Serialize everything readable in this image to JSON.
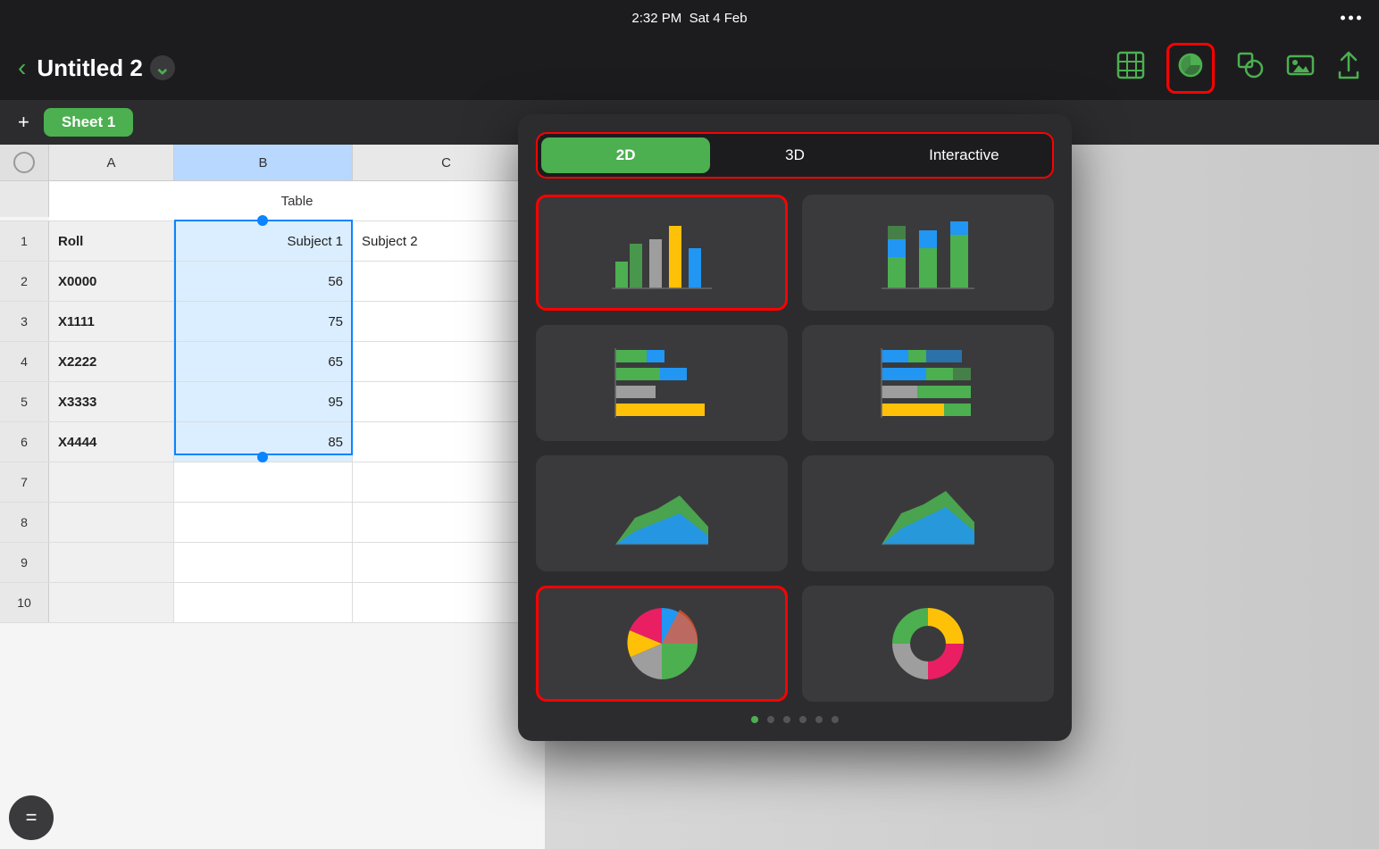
{
  "statusBar": {
    "time": "2:32 PM",
    "date": "Sat 4 Feb"
  },
  "toolbar": {
    "backLabel": "‹",
    "title": "Untitled 2",
    "chevron": "⌄",
    "icons": {
      "table": "table-icon",
      "chart": "chart-icon",
      "shape": "shape-icon",
      "media": "media-icon",
      "share": "share-icon"
    }
  },
  "sheetBar": {
    "addLabel": "+",
    "sheets": [
      "Sheet 1"
    ]
  },
  "spreadsheet": {
    "columns": [
      "A",
      "B",
      "C"
    ],
    "tableLabel": "Table",
    "rows": [
      {
        "num": 1,
        "a": "Roll",
        "b": "Subject 1",
        "c": "Subject 2"
      },
      {
        "num": 2,
        "a": "X0000",
        "b": "56",
        "c": ""
      },
      {
        "num": 3,
        "a": "X1111",
        "b": "75",
        "c": ""
      },
      {
        "num": 4,
        "a": "X2222",
        "b": "65",
        "c": ""
      },
      {
        "num": 5,
        "a": "X3333",
        "b": "95",
        "c": ""
      },
      {
        "num": 6,
        "a": "X4444",
        "b": "85",
        "c": ""
      },
      {
        "num": 7,
        "a": "",
        "b": "",
        "c": ""
      },
      {
        "num": 8,
        "a": "",
        "b": "",
        "c": ""
      },
      {
        "num": 9,
        "a": "",
        "b": "",
        "c": ""
      },
      {
        "num": 10,
        "a": "",
        "b": "",
        "c": ""
      }
    ]
  },
  "chartPopup": {
    "tabs": [
      "2D",
      "3D",
      "Interactive"
    ],
    "activeTab": "2D",
    "charts": [
      {
        "type": "bar-grouped",
        "selected": true
      },
      {
        "type": "bar-stacked",
        "selected": false
      },
      {
        "type": "bar-horizontal",
        "selected": false
      },
      {
        "type": "bar-horizontal-stacked",
        "selected": false
      },
      {
        "type": "area",
        "selected": false
      },
      {
        "type": "area-stacked",
        "selected": false
      },
      {
        "type": "pie",
        "selected": true
      },
      {
        "type": "donut",
        "selected": false
      }
    ],
    "paginationDots": 6,
    "activeDot": 0
  },
  "formulaBar": {
    "label": "="
  }
}
